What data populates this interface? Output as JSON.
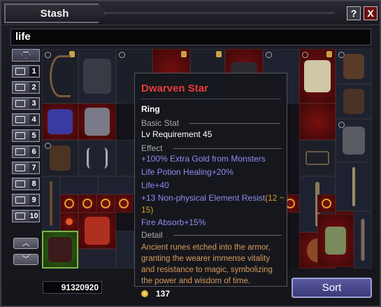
{
  "window": {
    "title": "Stash",
    "help_label": "?",
    "close_label": "X"
  },
  "search": {
    "value": "life"
  },
  "tabs": [
    {
      "label": "1"
    },
    {
      "label": "2"
    },
    {
      "label": "3"
    },
    {
      "label": "4"
    },
    {
      "label": "5"
    },
    {
      "label": "6"
    },
    {
      "label": "7"
    },
    {
      "label": "8"
    },
    {
      "label": "9"
    },
    {
      "label": "10"
    }
  ],
  "scroll": {
    "up": "︿",
    "down": "﹀"
  },
  "tooltip": {
    "name": "Dwarven Star",
    "type": "Ring",
    "basic_stat_header": "Basic Stat",
    "requirement": "Lv Requirement 45",
    "effect_header": "Effect",
    "effects": [
      "+100% Extra Gold from Monsters",
      "Life Potion Healing+20%",
      "Life+40"
    ],
    "resist_text": "+13 Non-physical Element Resist",
    "resist_range": "(12 ~ 15)",
    "fire_absorb": "Fire Absorb+15%",
    "detail_header": "Detail",
    "detail": "Ancient runes etched into the armor, granting the wearer immense vitality and resistance to magic, symbolizing the power and wisdom of time.",
    "price": "137"
  },
  "footer": {
    "gold": "91320920",
    "sort_label": "Sort"
  },
  "colors": {
    "item_name": "#e83a3a",
    "affix": "#8f8cf0",
    "detail": "#d99a5a",
    "range": "#e0a020"
  }
}
